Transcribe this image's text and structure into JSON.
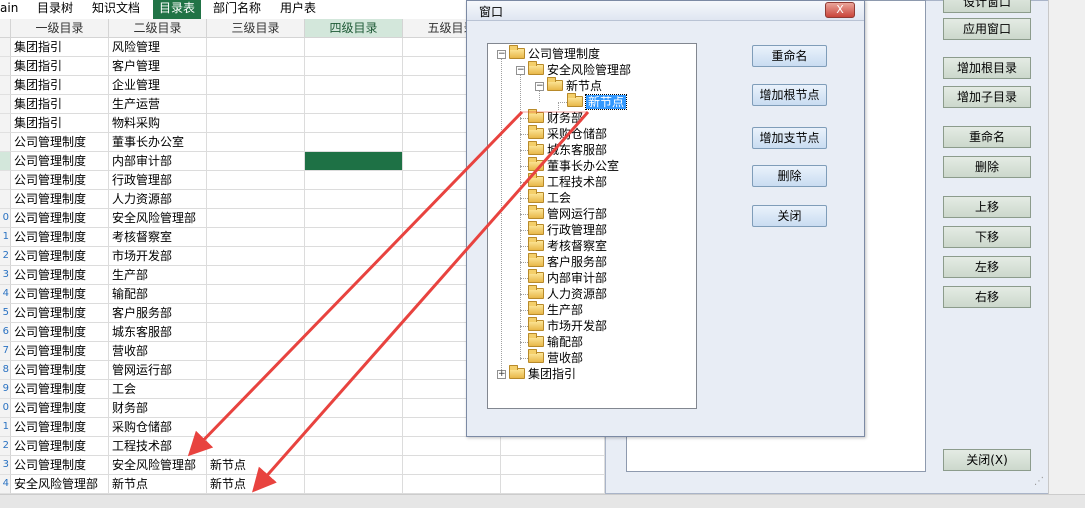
{
  "sheet_tabs": [
    {
      "label": "ain"
    },
    {
      "label": "目录树"
    },
    {
      "label": "知识文档"
    },
    {
      "label": "目录表"
    },
    {
      "label": "部门名称"
    },
    {
      "label": "用户表"
    }
  ],
  "active_tab": "目录表",
  "columns": [
    "一级目录",
    "二级目录",
    "三级目录",
    "四级目录",
    "五级目录"
  ],
  "rows": [
    {
      "num": "",
      "c1": "集团指引",
      "c2": "风险管理",
      "c3": ""
    },
    {
      "num": "",
      "c1": "集团指引",
      "c2": "客户管理",
      "c3": ""
    },
    {
      "num": "",
      "c1": "集团指引",
      "c2": "企业管理",
      "c3": ""
    },
    {
      "num": "",
      "c1": "集团指引",
      "c2": "生产运营",
      "c3": ""
    },
    {
      "num": "",
      "c1": "集团指引",
      "c2": "物料采购",
      "c3": ""
    },
    {
      "num": "",
      "c1": "公司管理制度",
      "c2": "董事长办公室",
      "c3": ""
    },
    {
      "num": "",
      "c1": "公司管理制度",
      "c2": "内部审计部",
      "c3": ""
    },
    {
      "num": "",
      "c1": "公司管理制度",
      "c2": "行政管理部",
      "c3": ""
    },
    {
      "num": "",
      "c1": "公司管理制度",
      "c2": "人力资源部",
      "c3": ""
    },
    {
      "num": "0",
      "c1": "公司管理制度",
      "c2": "安全风险管理部",
      "c3": ""
    },
    {
      "num": "1",
      "c1": "公司管理制度",
      "c2": "考核督察室",
      "c3": ""
    },
    {
      "num": "2",
      "c1": "公司管理制度",
      "c2": "市场开发部",
      "c3": ""
    },
    {
      "num": "3",
      "c1": "公司管理制度",
      "c2": "生产部",
      "c3": ""
    },
    {
      "num": "4",
      "c1": "公司管理制度",
      "c2": "输配部",
      "c3": ""
    },
    {
      "num": "5",
      "c1": "公司管理制度",
      "c2": "客户服务部",
      "c3": ""
    },
    {
      "num": "6",
      "c1": "公司管理制度",
      "c2": "城东客服部",
      "c3": ""
    },
    {
      "num": "7",
      "c1": "公司管理制度",
      "c2": "营收部",
      "c3": ""
    },
    {
      "num": "8",
      "c1": "公司管理制度",
      "c2": "管网运行部",
      "c3": ""
    },
    {
      "num": "9",
      "c1": "公司管理制度",
      "c2": "工会",
      "c3": ""
    },
    {
      "num": "0",
      "c1": "公司管理制度",
      "c2": "财务部",
      "c3": ""
    },
    {
      "num": "1",
      "c1": "公司管理制度",
      "c2": "采购仓储部",
      "c3": ""
    },
    {
      "num": "2",
      "c1": "公司管理制度",
      "c2": "工程技术部",
      "c3": ""
    },
    {
      "num": "3",
      "c1": "公司管理制度",
      "c2": "安全风险管理部",
      "c3": "新节点"
    },
    {
      "num": "4",
      "c1": "安全风险管理部",
      "c2": "新节点",
      "c3": "新节点"
    }
  ],
  "dialog": {
    "title": "窗口",
    "close_glyph": "X",
    "tree": {
      "root": "公司管理制度",
      "child": "安全风险管理部",
      "grandchild": "新节点",
      "selected": "新节点",
      "departments": [
        "财务部",
        "采购仓储部",
        "城东客服部",
        "董事长办公室",
        "工程技术部",
        "工会",
        "管网运行部",
        "行政管理部",
        "考核督察室",
        "客户服务部",
        "内部审计部",
        "人力资源部",
        "生产部",
        "市场开发部",
        "输配部",
        "营收部"
      ],
      "root2": "集团指引"
    },
    "buttons": {
      "rename": "重命名",
      "add_root": "增加根节点",
      "add_branch": "增加支节点",
      "delete": "删除",
      "close": "关闭"
    }
  },
  "right_panel": {
    "buttons": {
      "design_window": "设计窗口",
      "apply_window": "应用窗口",
      "add_root_dir": "增加根目录",
      "add_sub_dir": "增加子目录",
      "rename": "重命名",
      "delete": "删除",
      "move_up": "上移",
      "move_down": "下移",
      "move_left": "左移",
      "move_right": "右移",
      "close": "关闭(X)"
    }
  },
  "colors": {
    "excel_green": "#217346",
    "arrow_red": "#e8433f",
    "selection_blue": "#3399ff"
  }
}
